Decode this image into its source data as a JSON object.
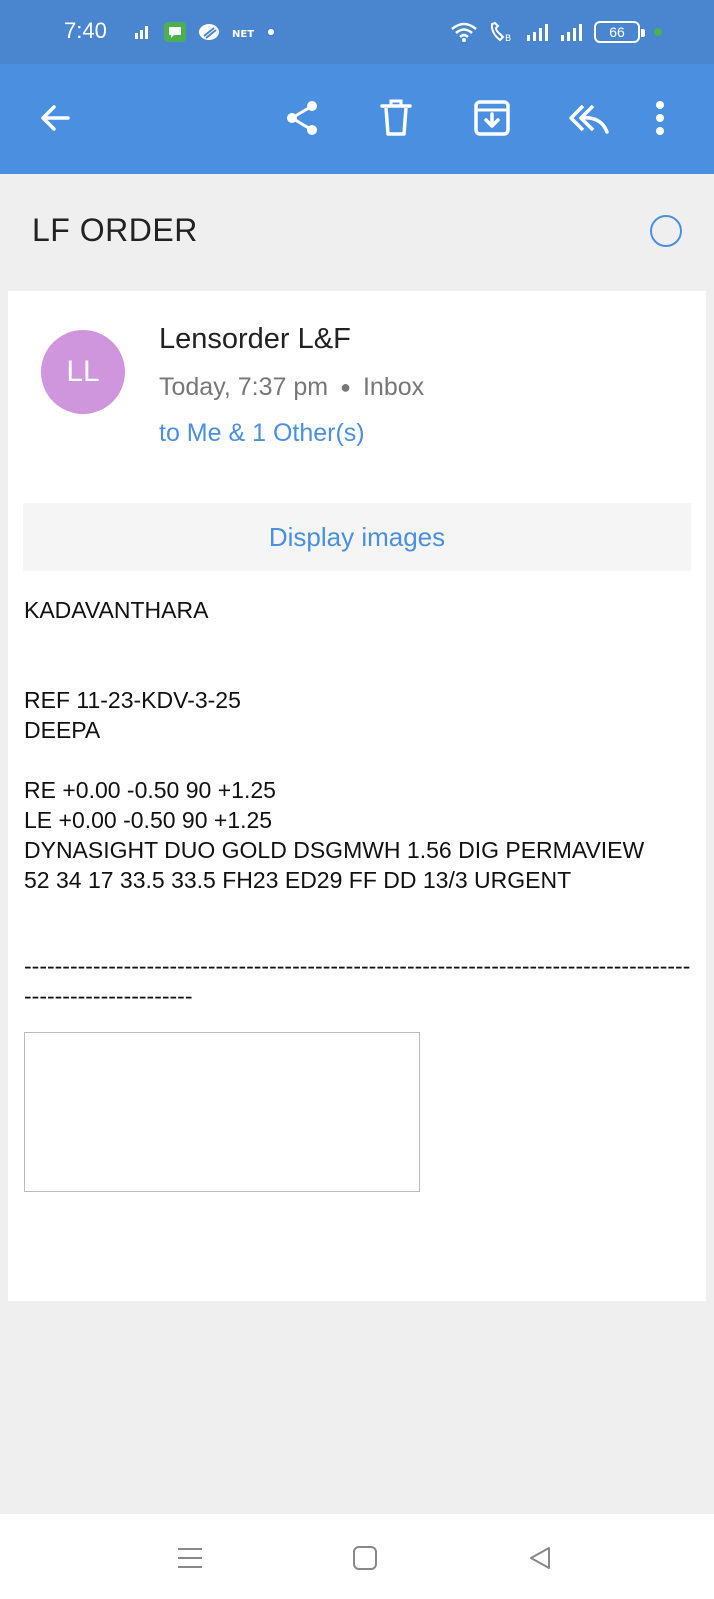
{
  "status_bar": {
    "time": "7:40",
    "battery": "66",
    "left_icons": [
      "signal-small-icon",
      "message-icon",
      "pinwheel-icon",
      "network-icon",
      "dot-icon"
    ],
    "right_icons": [
      "wifi-icon",
      "volte-call-icon",
      "signal-bars-icon",
      "signal-bars-icon",
      "battery-icon"
    ]
  },
  "toolbar": {
    "back": "back-arrow-icon",
    "share": "share-icon",
    "delete": "trash-icon",
    "archive": "archive-icon",
    "reply": "reply-all-icon",
    "more": "more-vert-icon"
  },
  "email": {
    "subject": "LF ORDER",
    "sender_initials": "LL",
    "sender_name": "Lensorder L&F",
    "time": "Today, 7:37 pm",
    "folder": "Inbox",
    "recipients": "to Me & 1 Other(s)",
    "display_images_label": "Display images",
    "body_lines": [
      "KADAVANTHARA",
      "",
      "",
      "REF 11-23-KDV-3-25",
      "DEEPA",
      "",
      "RE +0.00 -0.50 90 +1.25",
      "LE +0.00 -0.50 90 +1.25",
      "DYNASIGHT DUO GOLD DSGMWH 1.56 DIG PERMAVIEW",
      "52 34 17 33.5 33.5 FH23 ED29 FF DD 13/3 URGENT"
    ],
    "separator": "-------------------------------------------------------------------------------------------------------------"
  },
  "nav_bar": {
    "menu": "menu-icon",
    "home": "home-square-icon",
    "back": "back-triangle-icon"
  }
}
